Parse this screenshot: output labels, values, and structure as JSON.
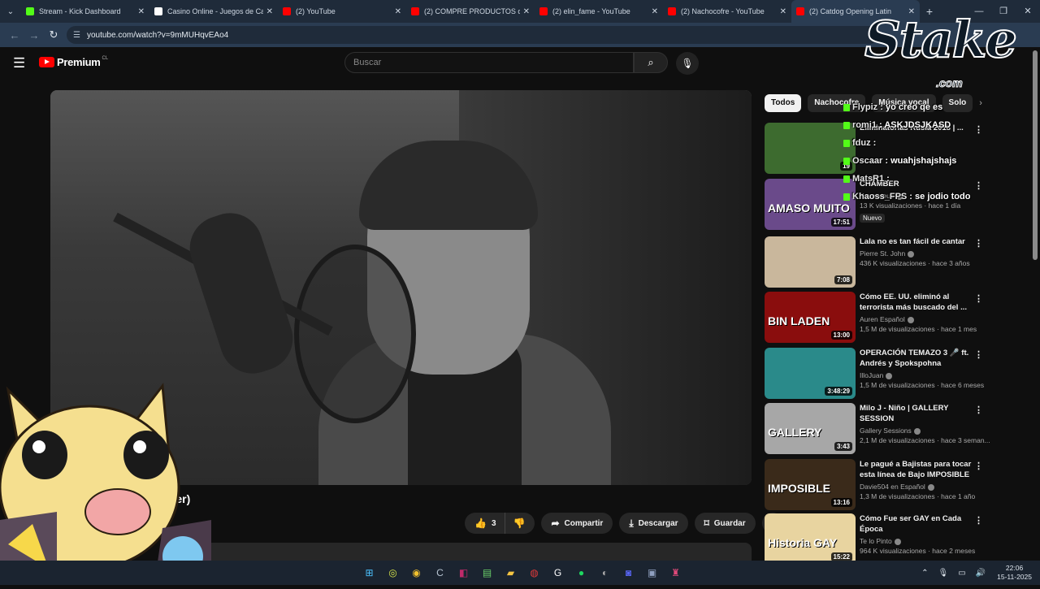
{
  "browser": {
    "tabs": [
      {
        "title": "Stream - Kick Dashboard",
        "favicon_color": "#53fc18",
        "active": false
      },
      {
        "title": "Casino Online - Juegos de Casi",
        "favicon_color": "#ffffff",
        "active": false
      },
      {
        "title": "(2) YouTube",
        "favicon_color": "#ff0000",
        "active": false
      },
      {
        "title": "(2) COMPRE PRODUCTOS de TI",
        "favicon_color": "#ff0000",
        "active": false
      },
      {
        "title": "(2) elin_fame - YouTube",
        "favicon_color": "#ff0000",
        "active": false
      },
      {
        "title": "(2) Nachocofre - YouTube",
        "favicon_color": "#ff0000",
        "active": false
      },
      {
        "title": "(2) Catdog Opening Latin",
        "favicon_color": "#ff0000",
        "active": true
      }
    ],
    "url": "youtube.com/watch?v=9mMUHqvEAo4"
  },
  "youtube": {
    "logo_text": "Premium",
    "country_code": "CL",
    "search_placeholder": "Buscar",
    "video_title_fragment": "over)",
    "likes": "3",
    "share_label": "Compartir",
    "download_label": "Descargar",
    "save_label": "Guardar",
    "chips": [
      "Todos",
      "Nachocofre",
      "Música vocal",
      "Solo"
    ],
    "recommendations": [
      {
        "title": "Eliminatorias Rusia 2018 | ...",
        "channel": "",
        "meta": "",
        "duration": "19",
        "thumb_color": "#3d6b2f",
        "thumb_text": ""
      },
      {
        "title": "CHAMBER",
        "channel": "Keznitdeus",
        "meta": "13 K visualizaciones · hace 1 día",
        "duration": "17:51",
        "badge": "Nuevo",
        "thumb_color": "#6a4a8a",
        "thumb_text": "AMASO MUITO"
      },
      {
        "title": "Lala no es tan fácil de cantar",
        "channel": "Pierre St. John",
        "meta": "436 K visualizaciones · hace 3 años",
        "duration": "7:08",
        "thumb_color": "#c9b79c",
        "thumb_text": ""
      },
      {
        "title": "Cómo EE. UU. eliminó al terrorista más buscado del ...",
        "channel": "Auren Español",
        "meta": "1,5 M de visualizaciones · hace 1 mes",
        "duration": "13:00",
        "thumb_color": "#8a0d0d",
        "thumb_text": "BIN LADEN"
      },
      {
        "title": "OPERACIÓN TEMAZO 3 🎤 ft. Andrés y Spokspohna",
        "channel": "IlloJuan",
        "meta": "1,5 M de visualizaciones · hace 6 meses",
        "duration": "3:48:29",
        "thumb_color": "#2a8a8a",
        "thumb_text": ""
      },
      {
        "title": "Milo J - Niño | GALLERY SESSION",
        "channel": "Gallery Sessions",
        "meta": "2,1 M de visualizaciones · hace 3 seman...",
        "duration": "3:43",
        "thumb_color": "#a7a7a7",
        "thumb_text": "GALLERY"
      },
      {
        "title": "Le pagué a Bajistas para tocar esta línea de Bajo IMPOSIBLE",
        "channel": "Davie504 en Español",
        "meta": "1,3 M de visualizaciones · hace 1 año",
        "duration": "13:16",
        "thumb_color": "#3a2a1a",
        "thumb_text": "IMPOSIBLE"
      },
      {
        "title": "Cómo Fue ser GAY en Cada Época",
        "channel": "Te lo Pinto",
        "meta": "964 K visualizaciones · hace 2 meses",
        "duration": "15:22",
        "thumb_color": "#e8d4a0",
        "thumb_text": "Historia GAY"
      }
    ]
  },
  "overlay": {
    "brand": "Stake",
    "brand_tld": ".com",
    "chat": [
      {
        "user": "Flypiz",
        "text": " : yo creo qe es"
      },
      {
        "user": "romi1",
        "text": " : ASKJDSJKASD"
      },
      {
        "user": "fduz",
        "text": " :"
      },
      {
        "user": "Oscaar",
        "text": " : wuahjshajshajs"
      },
      {
        "user": "MatsR1",
        "text": " :"
      },
      {
        "user": "Khaoss_FPS",
        "text": " : se jodio todo"
      }
    ]
  },
  "taskbar": {
    "time": "22:06",
    "date": "15-11-2025"
  }
}
